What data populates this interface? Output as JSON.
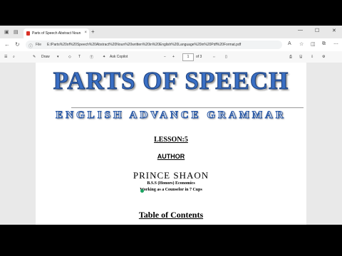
{
  "browser": {
    "tab_title": "Parts of Speech Abstract Noun -",
    "tab_close": "×",
    "new_tab": "+",
    "url_file_label": "File",
    "url": "E:/Parts%20of%20Speech%20Abstract%20Noun%20written%20in%20English%20Language%20in%20Pdf%20Format.pdf"
  },
  "pdf_toolbar": {
    "draw_label": "Draw",
    "ask_copilot_label": "Ask Copilot",
    "minus": "−",
    "plus": "+",
    "page_current": "1",
    "page_total": "of 3"
  },
  "document": {
    "title": "PARTS OF SPEECH",
    "subtitle": "ENGLISH ADVANCE GRAMMAR",
    "lesson": "LESSON:5",
    "author_heading": "AUTHOR",
    "author_name": "PRINCE SHAON",
    "degree": "B.S.S (Honors) Economics",
    "job": "Working as a Counselor in 7 Cups",
    "toc_heading": "Table of Contents"
  },
  "colors": {
    "title_blue": "#3a6fc4",
    "cursor_green": "#1aa260"
  }
}
